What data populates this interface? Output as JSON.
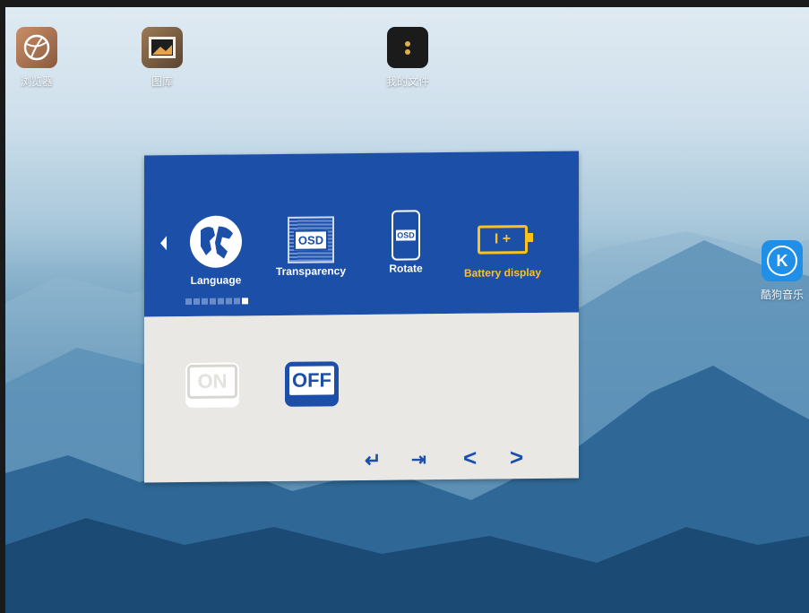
{
  "desktop": {
    "icons": [
      {
        "caption": "浏览器",
        "icon": "globe-icon"
      },
      {
        "caption": "图库",
        "icon": "gallery-icon"
      },
      {
        "caption": "我的文件",
        "icon": "file-manager-icon"
      },
      {
        "caption": "酷狗音乐",
        "icon": "kugou-k-icon",
        "glyph": "K"
      }
    ]
  },
  "osd": {
    "menu": [
      {
        "label": "Language",
        "icon": "globe-icon",
        "active": false
      },
      {
        "label": "Transparency",
        "icon": "osd-transparency-icon",
        "glyph": "OSD",
        "active": false
      },
      {
        "label": "Rotate",
        "icon": "osd-rotate-icon",
        "glyph": "OSD",
        "active": false
      },
      {
        "label": "Battery display",
        "icon": "battery-icon",
        "glyph": "I +",
        "active": true
      }
    ],
    "page_indicator": {
      "total": 8,
      "current": 8
    },
    "options": [
      {
        "label": "ON",
        "selected": false
      },
      {
        "label": "OFF",
        "selected": true
      }
    ],
    "nav": {
      "enter": "↵",
      "exit": "⇥",
      "prev": "<",
      "next": ">"
    }
  },
  "colors": {
    "osd_blue": "#1c4fa8",
    "osd_panel": "#e9e8e4",
    "active_yellow": "#ffc21a"
  }
}
